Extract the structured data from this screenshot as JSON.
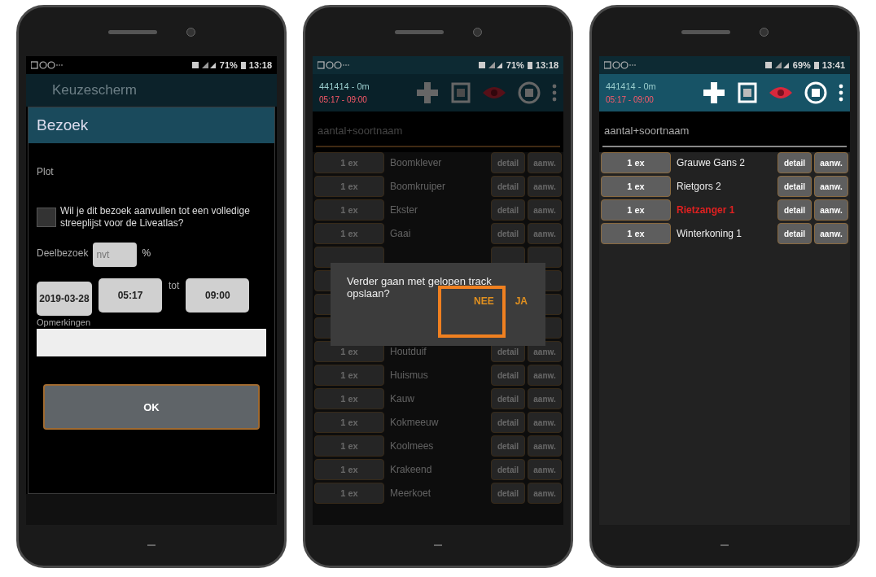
{
  "phones": [
    {
      "kind": "form",
      "status": {
        "battery": "71%",
        "time": "13:18"
      },
      "app_title": "Keuzescherm",
      "dialog_title": "Bezoek",
      "plot_label": "Plot",
      "checkbox": {
        "label": "Wil je dit bezoek aanvullen tot een volledige streeplijst voor de Liveatlas?",
        "checked": false
      },
      "deelbezoek": {
        "label": "Deelbezoek",
        "value": "nvt",
        "unit": "%"
      },
      "date": "2019-03-28",
      "start_time": "05:17",
      "between": "tot",
      "end_time": "09:00",
      "remarks_label": "Opmerkingen",
      "ok_button": "OK"
    },
    {
      "kind": "list",
      "status": {
        "battery": "71%",
        "time": "13:18"
      },
      "toolbar": {
        "location": "441414 - 0m",
        "period": "05:17 - 09:00"
      },
      "search": {
        "placeholder": "aantal+soortnaam"
      },
      "rows": [
        {
          "kind": "species",
          "count": "1 ex",
          "name": "Boomklever",
          "detail": "detail",
          "aanw": "aanw.",
          "highlighted": false
        },
        {
          "kind": "species",
          "count": "1 ex",
          "name": "Boomkruiper",
          "detail": "detail",
          "aanw": "aanw.",
          "highlighted": false
        },
        {
          "kind": "species",
          "count": "1 ex",
          "name": "Ekster",
          "detail": "detail",
          "aanw": "aanw.",
          "highlighted": false
        },
        {
          "kind": "species",
          "count": "1 ex",
          "name": "Gaai",
          "detail": "detail",
          "aanw": "aanw.",
          "highlighted": false
        },
        {
          "kind": "covered"
        },
        {
          "kind": "covered"
        },
        {
          "kind": "covered"
        },
        {
          "kind": "covered"
        },
        {
          "kind": "species",
          "count": "1 ex",
          "name": "Houtduif",
          "detail": "detail",
          "aanw": "aanw.",
          "highlighted": false
        },
        {
          "kind": "species",
          "count": "1 ex",
          "name": "Huismus",
          "detail": "detail",
          "aanw": "aanw.",
          "highlighted": false
        },
        {
          "kind": "species",
          "count": "1 ex",
          "name": "Kauw",
          "detail": "detail",
          "aanw": "aanw.",
          "highlighted": false
        },
        {
          "kind": "species",
          "count": "1 ex",
          "name": "Kokmeeuw",
          "detail": "detail",
          "aanw": "aanw.",
          "highlighted": false
        },
        {
          "kind": "species",
          "count": "1 ex",
          "name": "Koolmees",
          "detail": "detail",
          "aanw": "aanw.",
          "highlighted": false
        },
        {
          "kind": "species",
          "count": "1 ex",
          "name": "Krakeend",
          "detail": "detail",
          "aanw": "aanw.",
          "highlighted": false
        },
        {
          "kind": "species",
          "count": "1 ex",
          "name": "Meerkoet",
          "detail": "detail",
          "aanw": "aanw.",
          "highlighted": false
        }
      ],
      "dialog": {
        "message": "Verder gaan met gelopen track opslaan?",
        "buttons": [
          {
            "label": "NEE",
            "highlighted": true
          },
          {
            "label": "JA",
            "highlighted": false
          }
        ]
      }
    },
    {
      "kind": "list",
      "status": {
        "battery": "69%",
        "time": "13:41"
      },
      "toolbar": {
        "location": "441414 - 0m",
        "period": "05:17 - 09:00"
      },
      "search": {
        "placeholder": "aantal+soortnaam"
      },
      "rows": [
        {
          "kind": "species",
          "count": "1 ex",
          "name": "Grauwe Gans 2",
          "detail": "detail",
          "aanw": "aanw.",
          "highlighted": false
        },
        {
          "kind": "species",
          "count": "1 ex",
          "name": "Rietgors 2",
          "detail": "detail",
          "aanw": "aanw.",
          "highlighted": false
        },
        {
          "kind": "species",
          "count": "1 ex",
          "name": "Rietzanger 1",
          "detail": "detail",
          "aanw": "aanw.",
          "highlighted": true
        },
        {
          "kind": "species",
          "count": "1 ex",
          "name": "Winterkoning 1",
          "detail": "detail",
          "aanw": "aanw.",
          "highlighted": false
        }
      ]
    }
  ]
}
